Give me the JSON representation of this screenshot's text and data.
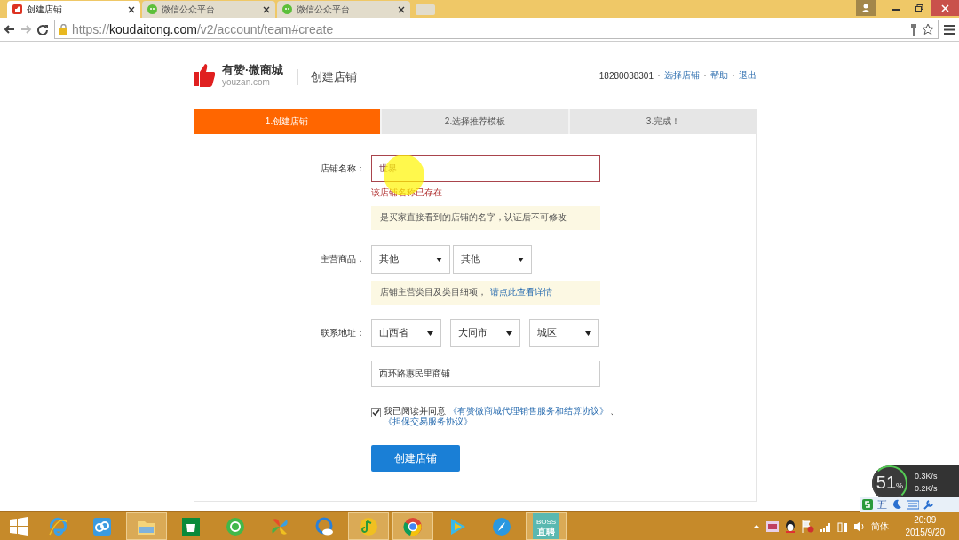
{
  "browser": {
    "tabs": [
      {
        "title": "创建店铺",
        "kind": "shop",
        "selected": true
      },
      {
        "title": "微信公众平台",
        "kind": "wechat",
        "selected": false
      },
      {
        "title": "微信公众平台",
        "kind": "wechat",
        "selected": false
      }
    ],
    "url": {
      "scheme": "https://",
      "host": "koudaitong.com",
      "path": "/v2/account/team#create"
    }
  },
  "header": {
    "logo_title": "有赞·微商城",
    "logo_sub": "youzan.com",
    "page_title": "创建店铺",
    "phone": "18280038301",
    "links": [
      "选择店铺",
      "帮助",
      "退出"
    ]
  },
  "steps": [
    {
      "label": "1.创建店铺",
      "selected": true
    },
    {
      "label": "2.选择推荐模板",
      "selected": false
    },
    {
      "label": "3.完成！",
      "selected": false
    }
  ],
  "form": {
    "name": {
      "label": "店铺名称：",
      "value": "世界",
      "error": "该店铺名称已存在",
      "hint": "是买家直接看到的店铺的名字，认证后不可修改"
    },
    "category": {
      "label": "主营商品：",
      "selects": [
        "其他",
        "其他"
      ],
      "hint": "店铺主营类目及类目细项，",
      "hint_link": "请点此查看详情"
    },
    "address": {
      "label": "联系地址：",
      "selects": [
        "山西省",
        "大同市",
        "城区"
      ],
      "detail": "西环路惠民里商铺"
    },
    "agreement": {
      "checked": true,
      "text": "我已阅读并同意",
      "links": [
        "《有赞微商城代理销售服务和结算协议》",
        "《担保交易服务协议》"
      ],
      "separator": "、"
    },
    "submit": "创建店铺"
  },
  "monitor": {
    "percent": "51",
    "unit": "%",
    "up": "0.3K/s",
    "down": "0.2K/s",
    "ime": "五"
  },
  "taskbar": {
    "apps": [
      {
        "kind": "ie",
        "running": false
      },
      {
        "kind": "cloud",
        "running": false
      },
      {
        "kind": "folder",
        "running": true
      },
      {
        "kind": "store",
        "running": false
      },
      {
        "kind": "refresh",
        "running": false
      },
      {
        "kind": "pinwheel",
        "running": false
      },
      {
        "kind": "qcloud",
        "running": false
      },
      {
        "kind": "music",
        "running": true
      },
      {
        "kind": "chrome",
        "running": true
      },
      {
        "kind": "play",
        "running": false
      },
      {
        "kind": "compass",
        "running": false
      },
      {
        "kind": "boss",
        "running": true,
        "label": [
          "BOSS",
          "直聘"
        ]
      }
    ],
    "language": "简体",
    "time": "20:09",
    "date": "2015/9/20"
  }
}
